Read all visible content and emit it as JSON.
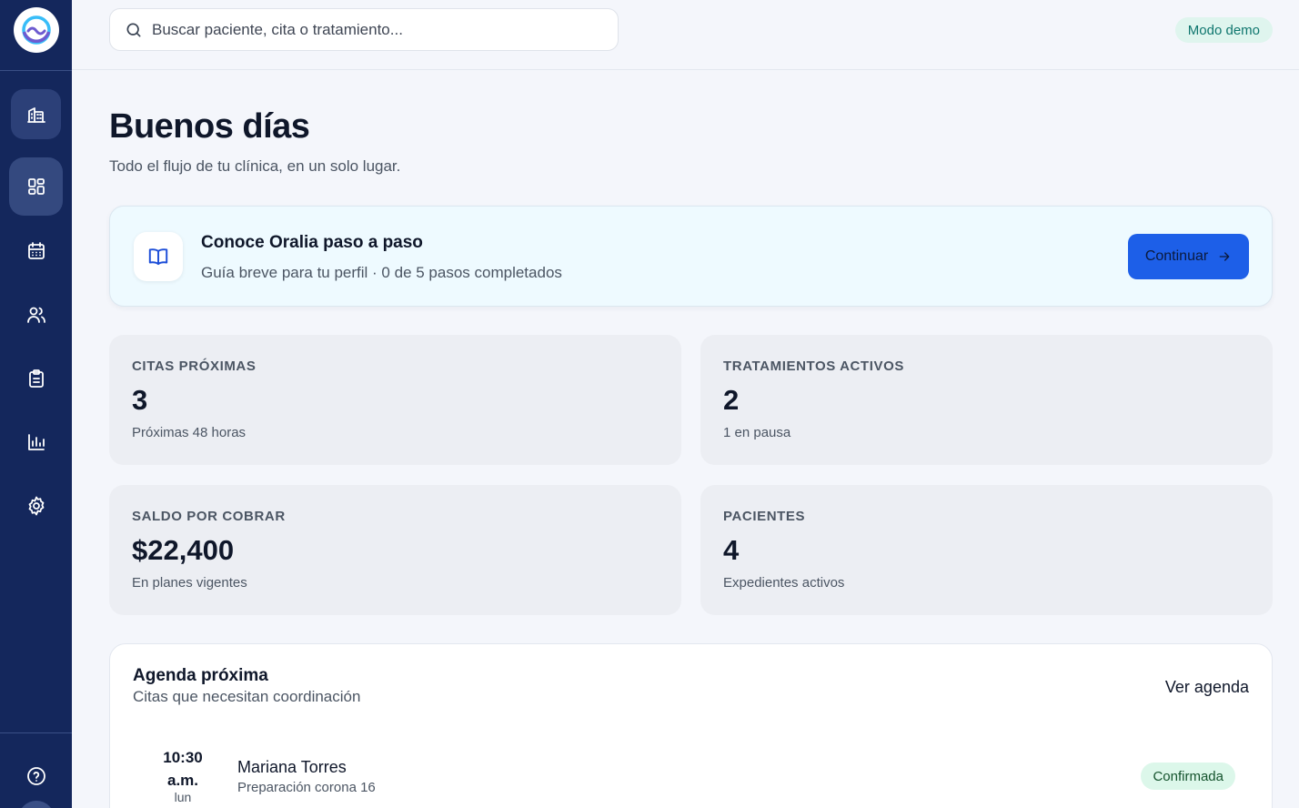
{
  "app": {
    "logo_icon": "oralia-logo",
    "accent_color": "#1d5fe8",
    "sidebar_color": "#14275c"
  },
  "sidebar": {
    "items": [
      {
        "id": "clinic",
        "icon": "building-icon"
      },
      {
        "id": "dashboard",
        "icon": "dashboard-grid-icon",
        "active": true
      },
      {
        "id": "calendar",
        "icon": "calendar-icon"
      },
      {
        "id": "patients",
        "icon": "users-icon"
      },
      {
        "id": "treatments",
        "icon": "clipboard-icon"
      },
      {
        "id": "reports",
        "icon": "bar-chart-icon"
      },
      {
        "id": "settings",
        "icon": "gear-icon"
      }
    ],
    "footer": [
      {
        "id": "help",
        "icon": "help-circle-icon"
      }
    ]
  },
  "header": {
    "search_placeholder": "Buscar paciente, cita o tratamiento...",
    "demo_badge": "Modo demo"
  },
  "main": {
    "greeting": "Buenos días",
    "subtitle": "Todo el flujo de tu clínica, en un solo lugar."
  },
  "guide": {
    "title": "Conoce Oralia paso a paso",
    "subtitle": "Guía breve para tu perfil · 0 de 5 pasos completados",
    "button_label": "Continuar",
    "steps_completed": 0,
    "steps_total": 5
  },
  "stats": [
    {
      "label": "CITAS PRÓXIMAS",
      "value": "3",
      "note": "Próximas 48 horas"
    },
    {
      "label": "TRATAMIENTOS ACTIVOS",
      "value": "2",
      "note": "1 en pausa"
    },
    {
      "label": "SALDO POR COBRAR",
      "value": "$22,400",
      "note": "En planes vigentes"
    },
    {
      "label": "PACIENTES",
      "value": "4",
      "note": "Expedientes activos"
    }
  ],
  "agenda": {
    "title": "Agenda próxima",
    "subtitle": "Citas que necesitan coordinación",
    "link_label": "Ver agenda",
    "appointments": [
      {
        "time_line1": "10:30",
        "time_line2": "a.m.",
        "day": "lun",
        "patient": "Mariana Torres",
        "procedure": "Preparación corona 16",
        "status": "Confirmada"
      }
    ]
  }
}
